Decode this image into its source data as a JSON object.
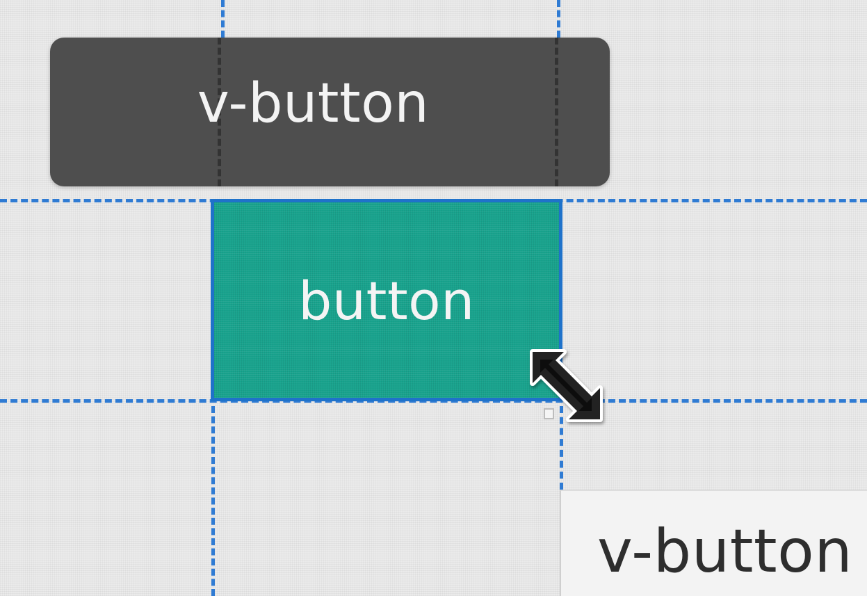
{
  "tooltip": {
    "label": "v-button"
  },
  "selection": {
    "label": "button",
    "fill_color": "#18a38d",
    "outline_color": "#1f72ca"
  },
  "cursor": {
    "icon": "resize-diagonal-icon"
  },
  "component": {
    "label": "v-button"
  },
  "guides": {
    "color": "#2f7bd3"
  }
}
